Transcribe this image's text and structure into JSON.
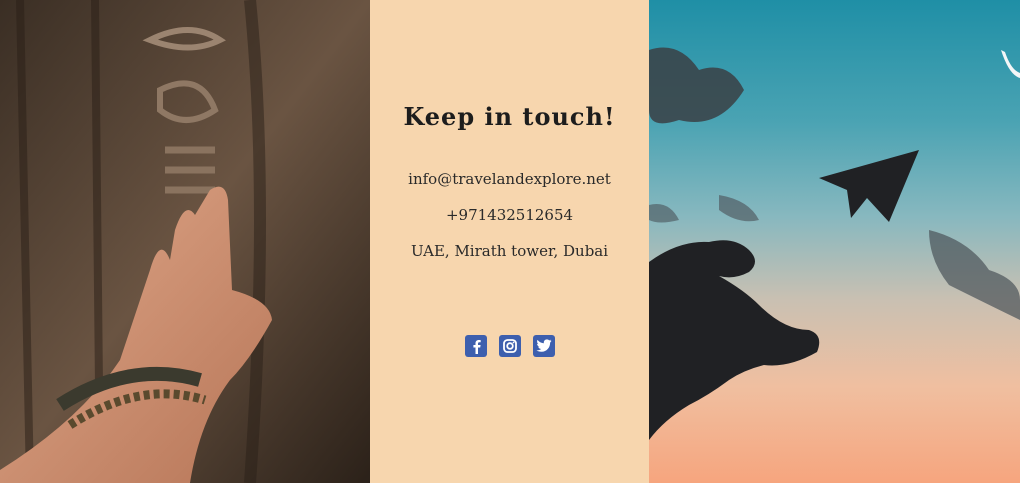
{
  "contact": {
    "title": "Keep in touch!",
    "email": "info@travelandexplore.net",
    "phone": "+971432512654",
    "address": "UAE, Mirath tower, Dubai"
  },
  "social": {
    "icons": [
      "facebook-icon",
      "instagram-icon",
      "twitter-icon"
    ],
    "icon_color": "#3d5fae"
  },
  "colors": {
    "panel_bg": "#f7d6ae"
  }
}
